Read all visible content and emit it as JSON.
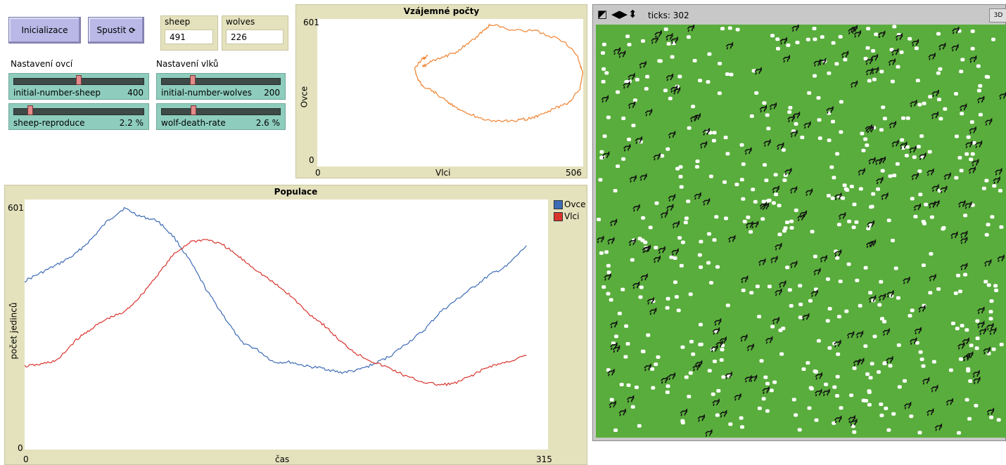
{
  "buttons": {
    "setup": "Inicializace",
    "go": "Spustit"
  },
  "monitors": [
    {
      "label": "sheep",
      "value": "491"
    },
    {
      "label": "wolves",
      "value": "226"
    }
  ],
  "groups": {
    "sheep": "Nastavení ovcí",
    "wolves": "Nastavení vlků"
  },
  "sliders": [
    {
      "name": "initial-number-sheep",
      "value": "400",
      "fraction": 0.5
    },
    {
      "name": "initial-number-wolves",
      "value": "200",
      "fraction": 0.25
    },
    {
      "name": "sheep-reproduce",
      "value": "2.2 %",
      "fraction": 0.11
    },
    {
      "name": "wolf-death-rate",
      "value": "2.6 %",
      "fraction": 0.26
    }
  ],
  "phase_plot": {
    "title": "Vzájemné počty",
    "xlabel": "Vlci",
    "ylabel": "Ovce",
    "xmin": "0",
    "xmax": "506",
    "ymin": "0",
    "ymax": "601",
    "color": "#f0822f"
  },
  "population_plot": {
    "title": "Populace",
    "xlabel": "čas",
    "ylabel": "počet jedinců",
    "xmin": "0",
    "xmax": "315",
    "ymin": "0",
    "ymax": "601",
    "legend": [
      {
        "name": "Ovce",
        "color": "#3d6bb5"
      },
      {
        "name": "Vlci",
        "color": "#d9332e"
      }
    ]
  },
  "view": {
    "ticks": "ticks: 302",
    "button_3d": "3D"
  },
  "chart_data": [
    {
      "type": "line",
      "title": "Populace",
      "xlabel": "čas",
      "ylabel": "počet jedinců",
      "xlim": [
        0,
        315
      ],
      "ylim": [
        0,
        601
      ],
      "grid": false,
      "legend": "right",
      "x": [
        0,
        10,
        20,
        30,
        40,
        50,
        60,
        70,
        80,
        90,
        100,
        110,
        120,
        130,
        140,
        150,
        160,
        170,
        180,
        190,
        200,
        210,
        220,
        230,
        240,
        250,
        260,
        270,
        280,
        290,
        302
      ],
      "series": [
        {
          "name": "Ovce",
          "color": "#3d6bb5",
          "values": [
            405,
            425,
            445,
            468,
            505,
            550,
            580,
            560,
            550,
            510,
            450,
            380,
            320,
            260,
            240,
            210,
            210,
            200,
            195,
            185,
            190,
            205,
            225,
            255,
            285,
            330,
            360,
            390,
            420,
            440,
            490
          ]
        },
        {
          "name": "Vlci",
          "color": "#d9332e",
          "values": [
            200,
            205,
            215,
            260,
            290,
            315,
            330,
            370,
            420,
            470,
            500,
            505,
            490,
            460,
            430,
            400,
            370,
            330,
            300,
            260,
            230,
            210,
            195,
            175,
            162,
            155,
            160,
            180,
            200,
            210,
            226
          ]
        }
      ]
    },
    {
      "type": "line",
      "title": "Vzájemné počty",
      "xlabel": "Vlci",
      "ylabel": "Ovce",
      "xlim": [
        0,
        506
      ],
      "ylim": [
        0,
        601
      ],
      "grid": false,
      "series": [
        {
          "name": "",
          "color": "#f0822f",
          "x": [
            200,
            215,
            240,
            265,
            290,
            315,
            330,
            365,
            420,
            470,
            495,
            505,
            500,
            480,
            455,
            425,
            405,
            385,
            360,
            320,
            300,
            270,
            250,
            225,
            200,
            190,
            185,
            200,
            210
          ],
          "y": [
            405,
            425,
            445,
            468,
            505,
            550,
            580,
            560,
            550,
            510,
            450,
            380,
            320,
            260,
            240,
            210,
            195,
            190,
            185,
            190,
            205,
            230,
            260,
            300,
            330,
            360,
            400,
            440,
            450
          ]
        }
      ]
    }
  ]
}
